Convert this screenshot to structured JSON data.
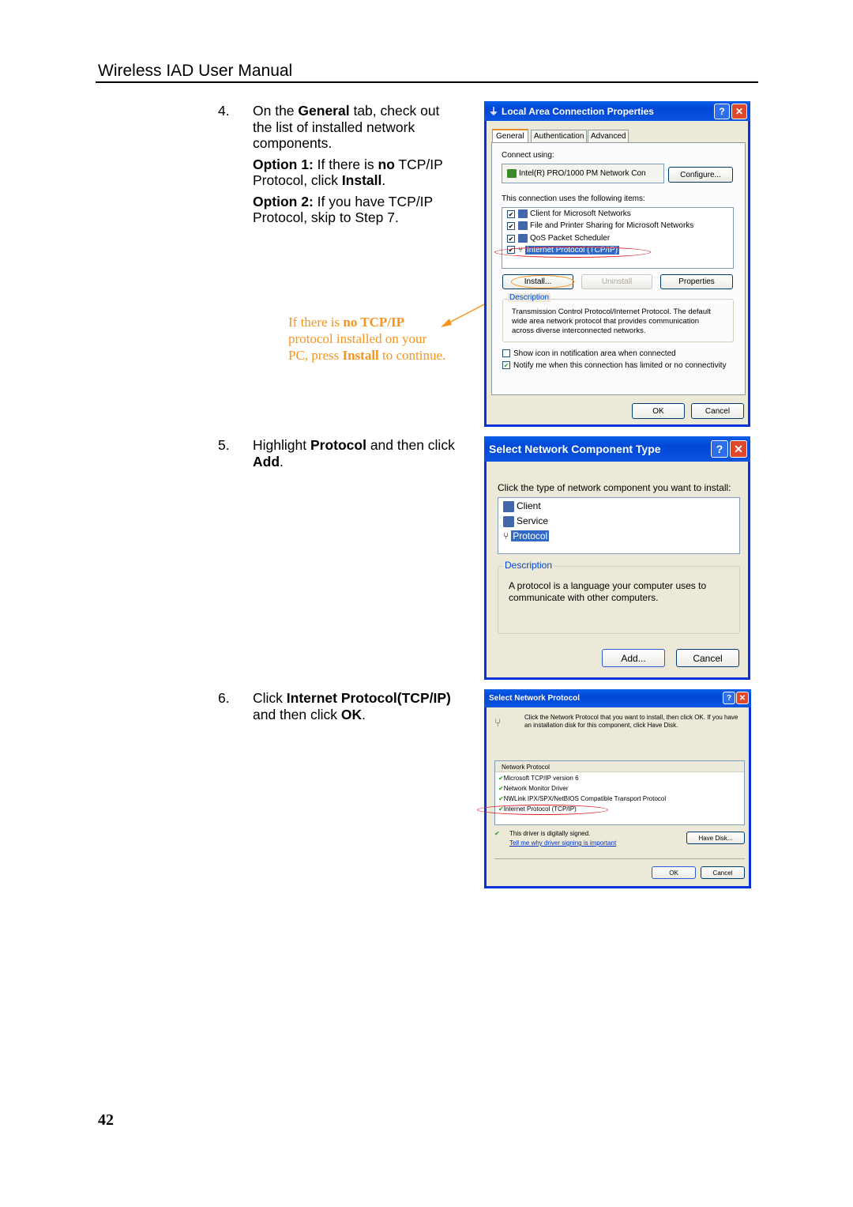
{
  "header": {
    "title": "Wireless IAD User Manual"
  },
  "steps": [
    {
      "num": "4.",
      "lines": [
        {
          "parts": [
            [
              "On the ",
              false
            ],
            [
              "General",
              true
            ],
            [
              " tab, check out",
              false
            ]
          ]
        }
      ],
      "text": "On the General tab, check out the list of installed network components.",
      "p1a": "On the ",
      "p1b": "General",
      "p1c": " tab, check out",
      "p2": "the list of installed network",
      "p3": "components.",
      "opt1_label": "Option 1:",
      "opt1_a": " If there is ",
      "opt1_b": "no",
      "opt1_c": " TCP/IP",
      "opt1_d": "Protocol, click ",
      "opt1_e": "Install",
      "opt1_f": ".",
      "opt2_label": "Option 2:",
      "opt2_a": " If you have TCP/IP",
      "opt2_b": "Protocol, skip to Step 7."
    },
    {
      "num": "5.",
      "a": "Highlight ",
      "b": "Protocol",
      "c": " and then click",
      "d": "Add",
      "e": "."
    },
    {
      "num": "6.",
      "a": "Click ",
      "b": "Internet Protocol(TCP/IP)",
      "c": "and then click ",
      "d": "OK",
      "e": "."
    }
  ],
  "callout": {
    "a": "If there is ",
    "b": "no TCP/IP",
    "c": "protocol installed on your",
    "d": "PC, press ",
    "e": "Install",
    "f": " to continue.",
    "color": "#f7941d"
  },
  "page_number": "42",
  "dialog1": {
    "title": "Local Area Connection Properties",
    "tabs": [
      "General",
      "Authentication",
      "Advanced"
    ],
    "connect_using": "Connect using:",
    "adapter": "Intel(R) PRO/1000 PM Network Con",
    "configure": "Configure...",
    "items_label": "This connection uses the following items:",
    "items": [
      {
        "label": "Client for Microsoft Networks",
        "checked": true
      },
      {
        "label": "File and Printer Sharing for Microsoft Networks",
        "checked": true
      },
      {
        "label": "QoS Packet Scheduler",
        "checked": true
      },
      {
        "label": "Internet Protocol (TCP/IP)",
        "checked": true,
        "selected": true
      }
    ],
    "install": "Install...",
    "uninstall": "Uninstall",
    "properties": "Properties",
    "description_label": "Description",
    "description": [
      "Transmission Control Protocol/Internet Protocol. The default",
      "wide area network protocol that provides communication",
      "across diverse interconnected networks."
    ],
    "show_icon": "Show icon in notification area when connected",
    "show_icon_checked": false,
    "notify": "Notify me when this connection has limited or no connectivity",
    "notify_checked": true,
    "ok": "OK",
    "cancel": "Cancel"
  },
  "dialog2": {
    "title": "Select Network Component Type",
    "prompt": "Click the type of network component you want to install:",
    "items": [
      "Client",
      "Service",
      "Protocol"
    ],
    "selected": "Protocol",
    "description_label": "Description",
    "description": [
      "A protocol is a language your computer uses to",
      "communicate with other computers."
    ],
    "add": "Add...",
    "cancel": "Cancel"
  },
  "dialog3": {
    "title": "Select Network Protocol",
    "instructions": [
      "Click the Network Protocol that you want to install, then click OK. If you have",
      "an installation disk for this component, click Have Disk."
    ],
    "list_header": "Network Protocol",
    "items": [
      "Microsoft TCP/IP version 6",
      "Network Monitor Driver",
      "NWLink IPX/SPX/NetBIOS Compatible Transport Protocol",
      "Internet Protocol (TCP/IP)"
    ],
    "signed": "This driver is digitally signed.",
    "signing_link": "Tell me why driver signing is important",
    "have_disk": "Have Disk...",
    "ok": "OK",
    "cancel": "Cancel"
  },
  "colors": {
    "titlebar": "#0054E3",
    "dialog_bg": "#ECE9D8",
    "highlight_oval_red": "#e0202a",
    "highlight_oval_orange": "#f7941d"
  }
}
